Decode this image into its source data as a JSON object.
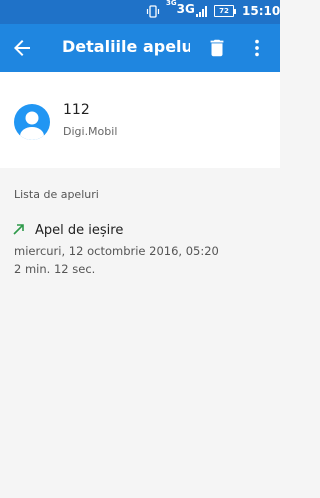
{
  "status_bar": {
    "network_prefix": "3G",
    "network": "3G",
    "battery": "72",
    "time": "15:10"
  },
  "app_bar": {
    "title": "Detaliile apelu..."
  },
  "contact": {
    "number": "112",
    "carrier": "Digi.Mobil"
  },
  "call_list": {
    "header": "Lista de apeluri",
    "entries": [
      {
        "type": "Apel de ieșire",
        "date": "miercuri, 12 octombrie 2016, 05:20",
        "duration": "2 min. 12 sec."
      }
    ]
  },
  "colors": {
    "status_bar": "#1f72c8",
    "app_bar": "#1f86e0",
    "avatar": "#2196f3",
    "outgoing_arrow": "#2e9a4a"
  }
}
